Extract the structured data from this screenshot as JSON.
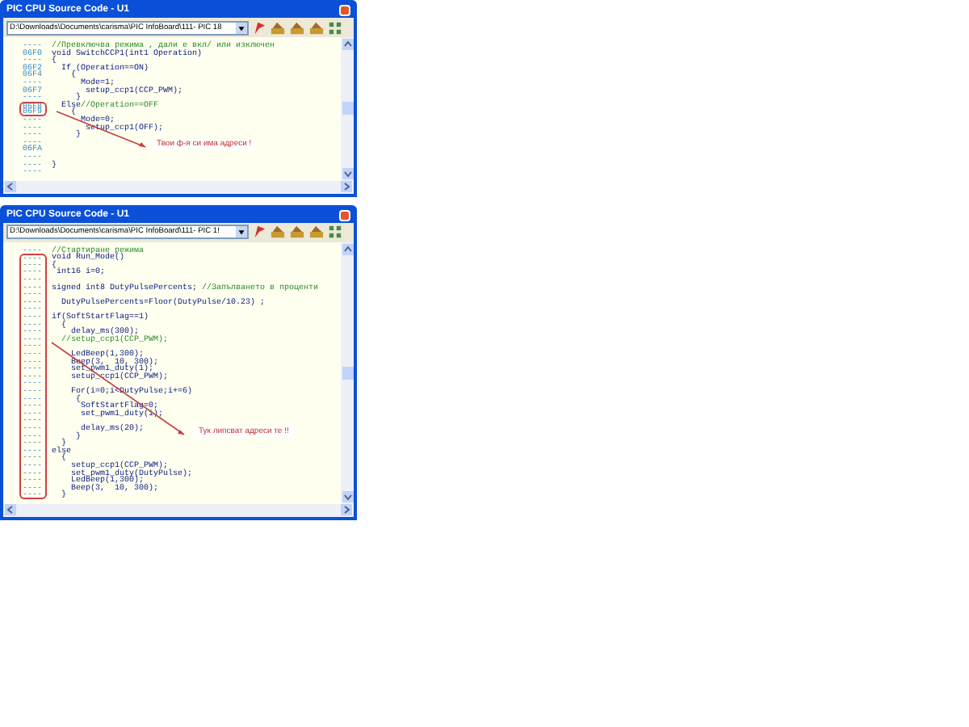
{
  "windows": [
    {
      "title": "PIC CPU Source Code - U1",
      "path": "D:\\Downloads\\Documents\\carisma\\PIC InfoBoard\\111- PIC 18",
      "callout": "Твои ф-я си има адреси !",
      "lines": [
        {
          "addr": "----",
          "comment": "//Превключва режима , дали е вкл/ или изключен",
          "marked": false
        },
        {
          "addr": "06F0",
          "code": "void SwitchCCP1(int1 Operation)",
          "marked": false
        },
        {
          "addr": "----",
          "code": "{",
          "marked": false
        },
        {
          "addr": "06F2",
          "code": "  If (Operation==ON)",
          "marked": false
        },
        {
          "addr": "06F4",
          "code": "    {",
          "marked": false
        },
        {
          "addr": "----",
          "code": "      Mode=1;",
          "marked": false
        },
        {
          "addr": "06F7",
          "code": "       setup_ccp1(CCP_PWM);",
          "marked": false
        },
        {
          "addr": "----",
          "code": "     }",
          "marked": false
        },
        {
          "addr": "06F8",
          "code": "  Else",
          "comment": "//Operation==OFF",
          "marked": true
        },
        {
          "addr": "06F9",
          "code": "    {",
          "marked": true
        },
        {
          "addr": "----",
          "code": "      Mode=0;",
          "marked": false
        },
        {
          "addr": "----",
          "code": "       setup_ccp1(OFF);",
          "marked": false
        },
        {
          "addr": "----",
          "code": "     }",
          "marked": false
        },
        {
          "addr": "----",
          "marked": false
        },
        {
          "addr": "06FA",
          "marked": false
        },
        {
          "addr": "----",
          "marked": false
        },
        {
          "addr": "----",
          "code": "}",
          "marked": false
        },
        {
          "addr": "----",
          "marked": false
        }
      ]
    },
    {
      "title": "PIC CPU Source Code - U1",
      "path": "D:\\Downloads\\Documents\\carisma\\PIC InfoBoard\\111- PIC 1!",
      "callout": "Тук липсват адреси те !!",
      "lines": [
        {
          "addr": "----",
          "comment": "//Стартиране режима",
          "marked": false
        },
        {
          "addr": "----",
          "code": "void Run_Mode()",
          "marked": true
        },
        {
          "addr": "----",
          "code": "{",
          "marked": true
        },
        {
          "addr": "----",
          "code": " int16 i=0;",
          "marked": true
        },
        {
          "addr": "----",
          "marked": true
        },
        {
          "addr": "----",
          "code": "signed int8 DutyPulsePercents; ",
          "comment": "//Запълването в проценти",
          "marked": true
        },
        {
          "addr": "----",
          "marked": true
        },
        {
          "addr": "----",
          "code": "  DutyPulsePercents=Floor(DutyPulse/10.23) ;",
          "marked": true
        },
        {
          "addr": "----",
          "marked": true
        },
        {
          "addr": "----",
          "code": "if(SoftStartFlag==1)",
          "marked": true
        },
        {
          "addr": "----",
          "code": "  {",
          "marked": true
        },
        {
          "addr": "----",
          "code": "    delay_ms(300);",
          "marked": true
        },
        {
          "addr": "----",
          "comment": "  //setup_ccp1(CCP_PWM);",
          "marked": true
        },
        {
          "addr": "----",
          "marked": true
        },
        {
          "addr": "----",
          "code": "    LedBeep(1,300);",
          "marked": true
        },
        {
          "addr": "----",
          "code": "    Beep(3,  10, 300);",
          "marked": true
        },
        {
          "addr": "----",
          "code": "    set_pwm1_duty(1);",
          "marked": true
        },
        {
          "addr": "----",
          "code": "    setup_ccp1(CCP_PWM);",
          "marked": true
        },
        {
          "addr": "----",
          "marked": true
        },
        {
          "addr": "----",
          "code": "    For(i=0;i<DutyPulse;i+=6)",
          "marked": true
        },
        {
          "addr": "----",
          "code": "     {",
          "marked": true
        },
        {
          "addr": "----",
          "code": "      SoftStartFlag=0;",
          "marked": true
        },
        {
          "addr": "----",
          "code": "      set_pwm1_duty(i);",
          "marked": true
        },
        {
          "addr": "----",
          "marked": true
        },
        {
          "addr": "----",
          "code": "      delay_ms(20);",
          "marked": true
        },
        {
          "addr": "----",
          "code": "     }",
          "marked": true
        },
        {
          "addr": "----",
          "code": "  }",
          "marked": true
        },
        {
          "addr": "----",
          "code": "else",
          "marked": true
        },
        {
          "addr": "----",
          "code": "  {",
          "marked": true
        },
        {
          "addr": "----",
          "code": "    setup_ccp1(CCP_PWM);",
          "marked": true
        },
        {
          "addr": "----",
          "code": "    set_pwm1_duty(DutyPulse);",
          "marked": true
        },
        {
          "addr": "----",
          "code": "    LedBeep(1,300);",
          "marked": true
        },
        {
          "addr": "----",
          "code": "    Beep(3,  10, 300);",
          "marked": true
        },
        {
          "addr": "----",
          "code": "  }",
          "marked": true
        }
      ]
    }
  ]
}
